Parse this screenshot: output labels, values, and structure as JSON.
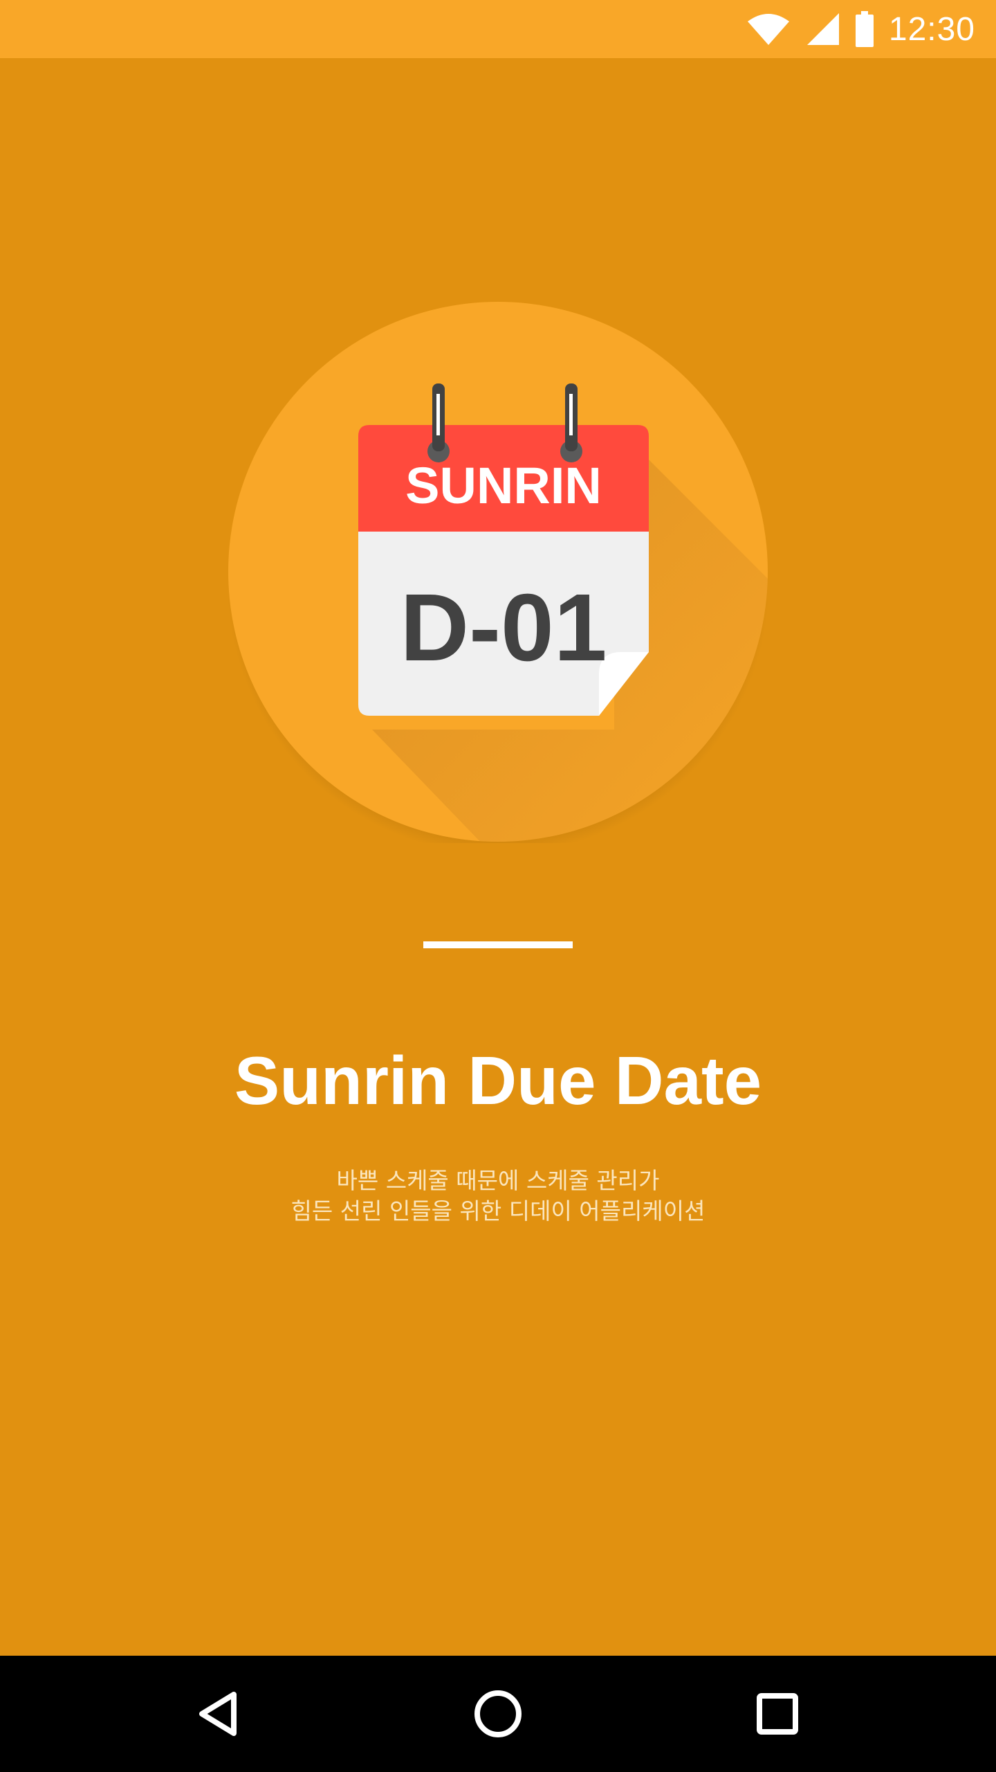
{
  "status_bar": {
    "time": "12:30",
    "icons": [
      "wifi-icon",
      "cell-signal-icon",
      "battery-icon"
    ],
    "background": "#F9A728"
  },
  "splash": {
    "background": "#E19110",
    "logo": {
      "banner_text": "SUNRIN",
      "countdown_text": "D-01",
      "circle_color": "#F9A728",
      "banner_color": "#FF4A3D",
      "page_color": "#F0F0F0"
    },
    "title": "Sunrin Due Date",
    "description_lines": [
      "바쁜 스케줄 때문에 스케줄 관리가",
      "힘든 선린 인들을 위한 디데이 어플리케이션"
    ]
  },
  "navigation_bar": {
    "buttons": [
      "back-icon",
      "home-icon",
      "recents-icon"
    ]
  }
}
